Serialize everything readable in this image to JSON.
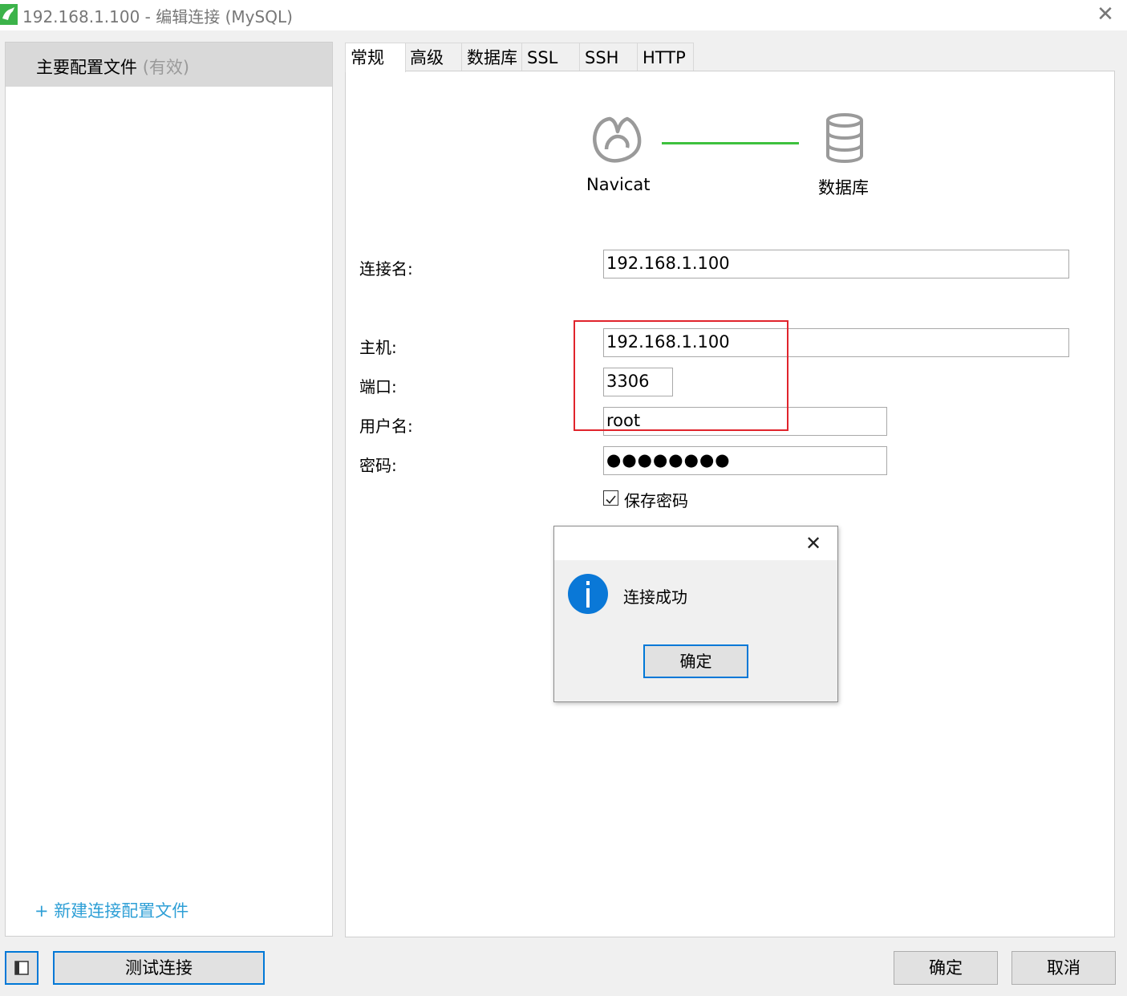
{
  "window": {
    "title": "192.168.1.100 - 编辑连接 (MySQL)",
    "close_glyph": "✕"
  },
  "sidebar": {
    "profile_name": "主要配置文件",
    "profile_status": "(有效)",
    "new_profile_link": "+ 新建连接配置文件"
  },
  "tabs": [
    {
      "label": "常规",
      "active": true
    },
    {
      "label": "高级"
    },
    {
      "label": "数据库"
    },
    {
      "label": "SSL"
    },
    {
      "label": "SSH"
    },
    {
      "label": "HTTP"
    }
  ],
  "illustration": {
    "left_label": "Navicat",
    "right_label": "数据库",
    "line_color": "#3ec13e",
    "left_icon": "navicat-logo-icon",
    "right_icon": "database-icon"
  },
  "form": {
    "connection_name_label": "连接名:",
    "connection_name_value": "192.168.1.100",
    "host_label": "主机:",
    "host_value": "192.168.1.100",
    "port_label": "端口:",
    "port_value": "3306",
    "user_label": "用户名:",
    "user_value": "root",
    "password_label": "密码:",
    "password_value": "●●●●●●●●",
    "save_password_label": "保存密码",
    "save_password_checked": true
  },
  "message_box": {
    "text": "连接成功",
    "ok_label": "确定",
    "icon": "info-icon",
    "close_glyph": "✕"
  },
  "footer": {
    "test_button": "测试连接",
    "ok_button": "确定",
    "cancel_button": "取消"
  },
  "colors": {
    "accent": "#0078d7",
    "highlight": "#e0242c",
    "link": "#2e9fd6",
    "info": "#0a78d7"
  }
}
